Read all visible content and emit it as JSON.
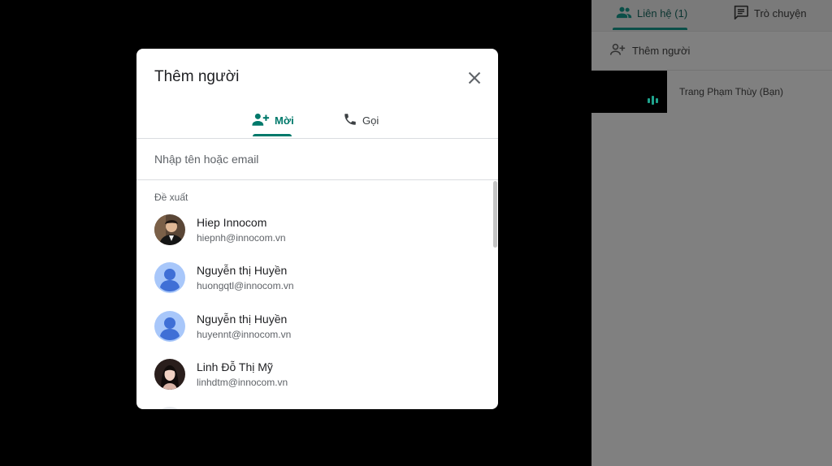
{
  "side_panel": {
    "tabs": [
      {
        "label": "Liên hệ (1)",
        "icon": "people-icon"
      },
      {
        "label": "Trò chuyện",
        "icon": "chat-icon"
      }
    ],
    "add_person_label": "Thêm người",
    "participants": [
      {
        "name": "Trang Phạm Thùy (Bạn)"
      }
    ]
  },
  "modal": {
    "title": "Thêm người",
    "tabs": [
      {
        "label": "Mời",
        "icon": "person-add-icon",
        "active": true
      },
      {
        "label": "Gọi",
        "icon": "phone-icon",
        "active": false
      }
    ],
    "search_placeholder": "Nhập tên hoặc email",
    "suggestions_label": "Đề xuất",
    "suggestions": [
      {
        "name": "Hiep Innocom",
        "email": "hiepnh@innocom.vn",
        "avatar": "photo"
      },
      {
        "name": "Nguyễn thị Huyền",
        "email": "huongqtl@innocom.vn",
        "avatar": "default"
      },
      {
        "name": "Nguyễn thị Huyền",
        "email": "huyennt@innocom.vn",
        "avatar": "default"
      },
      {
        "name": "Linh Đỗ Thị Mỹ",
        "email": "linhdtm@innocom.vn",
        "avatar": "photo"
      }
    ]
  },
  "colors": {
    "accent": "#00796b",
    "side_panel_bg": "#808080",
    "backdrop": "#000000"
  }
}
